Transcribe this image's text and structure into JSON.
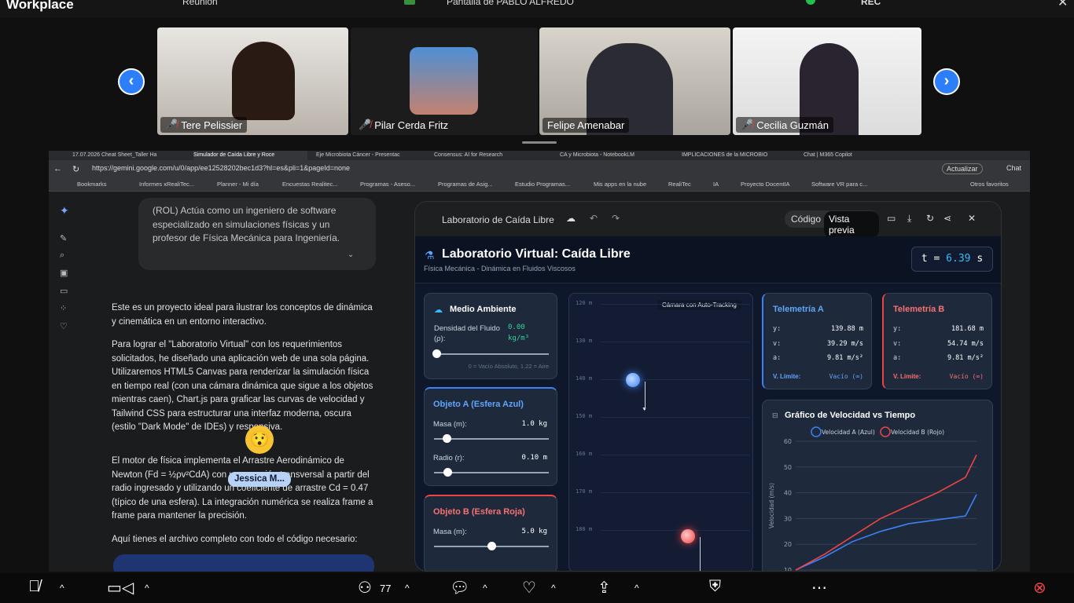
{
  "topbar": {
    "app_title": "Workplace",
    "meeting_label": "Reunión",
    "screen_label": "Pantalla de PABLO ALFREDO",
    "rec": "REC"
  },
  "participants": [
    {
      "name": "Tere Pelissier"
    },
    {
      "name": "Pilar Cerda Fritz"
    },
    {
      "name": "Felipe Amenabar"
    },
    {
      "name": "Cecilia Guzmán"
    }
  ],
  "browser": {
    "tabs": [
      "17.07.2026 Cheat Sheet_Taller Ha",
      "Simulador de Caída Libre y Roce",
      "Eje Microbiota Cáncer - Presentac",
      "Consensus: AI for Research",
      "CA y Microbiota - NotebookLM",
      "IMPLICACIONES de la MICROBIO",
      "Chat | M365 Copilot"
    ],
    "url": "https://gemini.google.com/u/0/app/ee12528202bec1d3?hl=es&pli=1&pageId=none",
    "update_label": "Actualizar",
    "chat_label": "Chat",
    "bookmarks": [
      "Bookmarks",
      "Informes xRealiTec...",
      "Planner - Mi día",
      "Encuestas Realitec...",
      "Programas - Aseso...",
      "Programas de Asig...",
      "Estudio Programas...",
      "Mis apps en la nube",
      "RealiTec",
      "IA",
      "Proyecto DocentIA",
      "Software VR para c..."
    ],
    "other_bookmarks": "Otros favoritos"
  },
  "chat": {
    "role_text": "(ROL) Actúa como un ingeniero de software especializado en simulaciones físicas y un profesor de Física Mecánica para Ingeniería.",
    "p1": "Este es un proyecto ideal para ilustrar los conceptos de dinámica y cinemática en un entorno interactivo.",
    "p2": "Para lograr el \"Laboratorio Virtual\" con los requerimientos solicitados, he diseñado una aplicación web de una sola página. Utilizaremos HTML5 Canvas para renderizar la simulación física en tiempo real (con una cámara dinámica que sigue a los objetos mientras caen), Chart.js para graficar las curvas de velocidad y Tailwind CSS para estructurar una interfaz moderna, oscura (estilo \"Dark Mode\" de IDEs) y responsiva.",
    "p3": "El motor de física implementa el Arrastre Aerodinámico de Newton (Fd = ½ρv²CdA) con una sección transversal a partir del radio ingresado y utilizando un coeficiente de arrastre Cd = 0.47 (típico de una esfera). La integración numérica se realiza frame a frame para mantener la precisión.",
    "p4": "Aquí tienes el archivo completo con todo el código necesario:",
    "cursor_label": "Jessica M..."
  },
  "panel": {
    "title": "Laboratorio de Caída Libre",
    "code_tab": "Código",
    "preview_tab": "Vista previa",
    "lab_title": "Laboratorio Virtual: Caída Libre",
    "lab_subtitle": "Física Mecánica - Dinámica en Fluidos Viscosos",
    "time_label": "t =",
    "time_value": "6.39",
    "time_unit": "s",
    "medio": {
      "title": "Medio Ambiente",
      "label": "Densidad del Fluido (ρ):",
      "value": "0.00",
      "unit": "kg/m³",
      "hint": "0 = Vacío Absoluto, 1.22 = Aire",
      "level": 0.0
    },
    "objA": {
      "title": "Objeto A (Esfera Azul)",
      "mass_label": "Masa (m):",
      "mass": "1.0 kg",
      "radius_label": "Radio (r):",
      "radius": "0.10 m",
      "mass_level": 0.09,
      "radius_level": 0.1
    },
    "objB": {
      "title": "Objeto B (Esfera Roja)",
      "mass_label": "Masa (m):",
      "mass": "5.0 kg",
      "mass_level": 0.5
    },
    "camera_label": "Cámara con Auto-Tracking",
    "ruler": [
      "120 m",
      "130 m",
      "140 m",
      "150 m",
      "160 m",
      "170 m",
      "180 m"
    ],
    "telA": {
      "title": "Telemetría A",
      "y": "139.88 m",
      "v": "39.29 m/s",
      "a": "9.81 m/s²",
      "vlim_label": "V. Límite:",
      "vlim": "Vacío (∞)"
    },
    "telB": {
      "title": "Telemetría B",
      "y": "181.68 m",
      "v": "54.74 m/s",
      "a": "9.81 m/s²",
      "vlim_label": "V. Límite:",
      "vlim": "Vacío (∞)"
    },
    "graph_title": "Gráfico de Velocidad vs Tiempo"
  },
  "chart_data": {
    "type": "line",
    "title": "Gráfico de Velocidad vs Tiempo",
    "ylabel": "Velocidad (m/s)",
    "xlabel": "",
    "ylim": [
      10,
      60
    ],
    "yticks": [
      10,
      20,
      30,
      40,
      50,
      60
    ],
    "x": [
      0,
      1,
      2,
      3,
      4,
      5,
      6,
      6.39
    ],
    "series": [
      {
        "name": "Velocidad A (Azul)",
        "color": "#3b82f6",
        "values": [
          10,
          15,
          21,
          25,
          28,
          29.5,
          31,
          39.3
        ]
      },
      {
        "name": "Velocidad B (Rojo)",
        "color": "#ef4444",
        "values": [
          10,
          16,
          23,
          30,
          35,
          40,
          46,
          54.7
        ]
      }
    ]
  },
  "bottombar": {
    "participants_count": "77"
  }
}
